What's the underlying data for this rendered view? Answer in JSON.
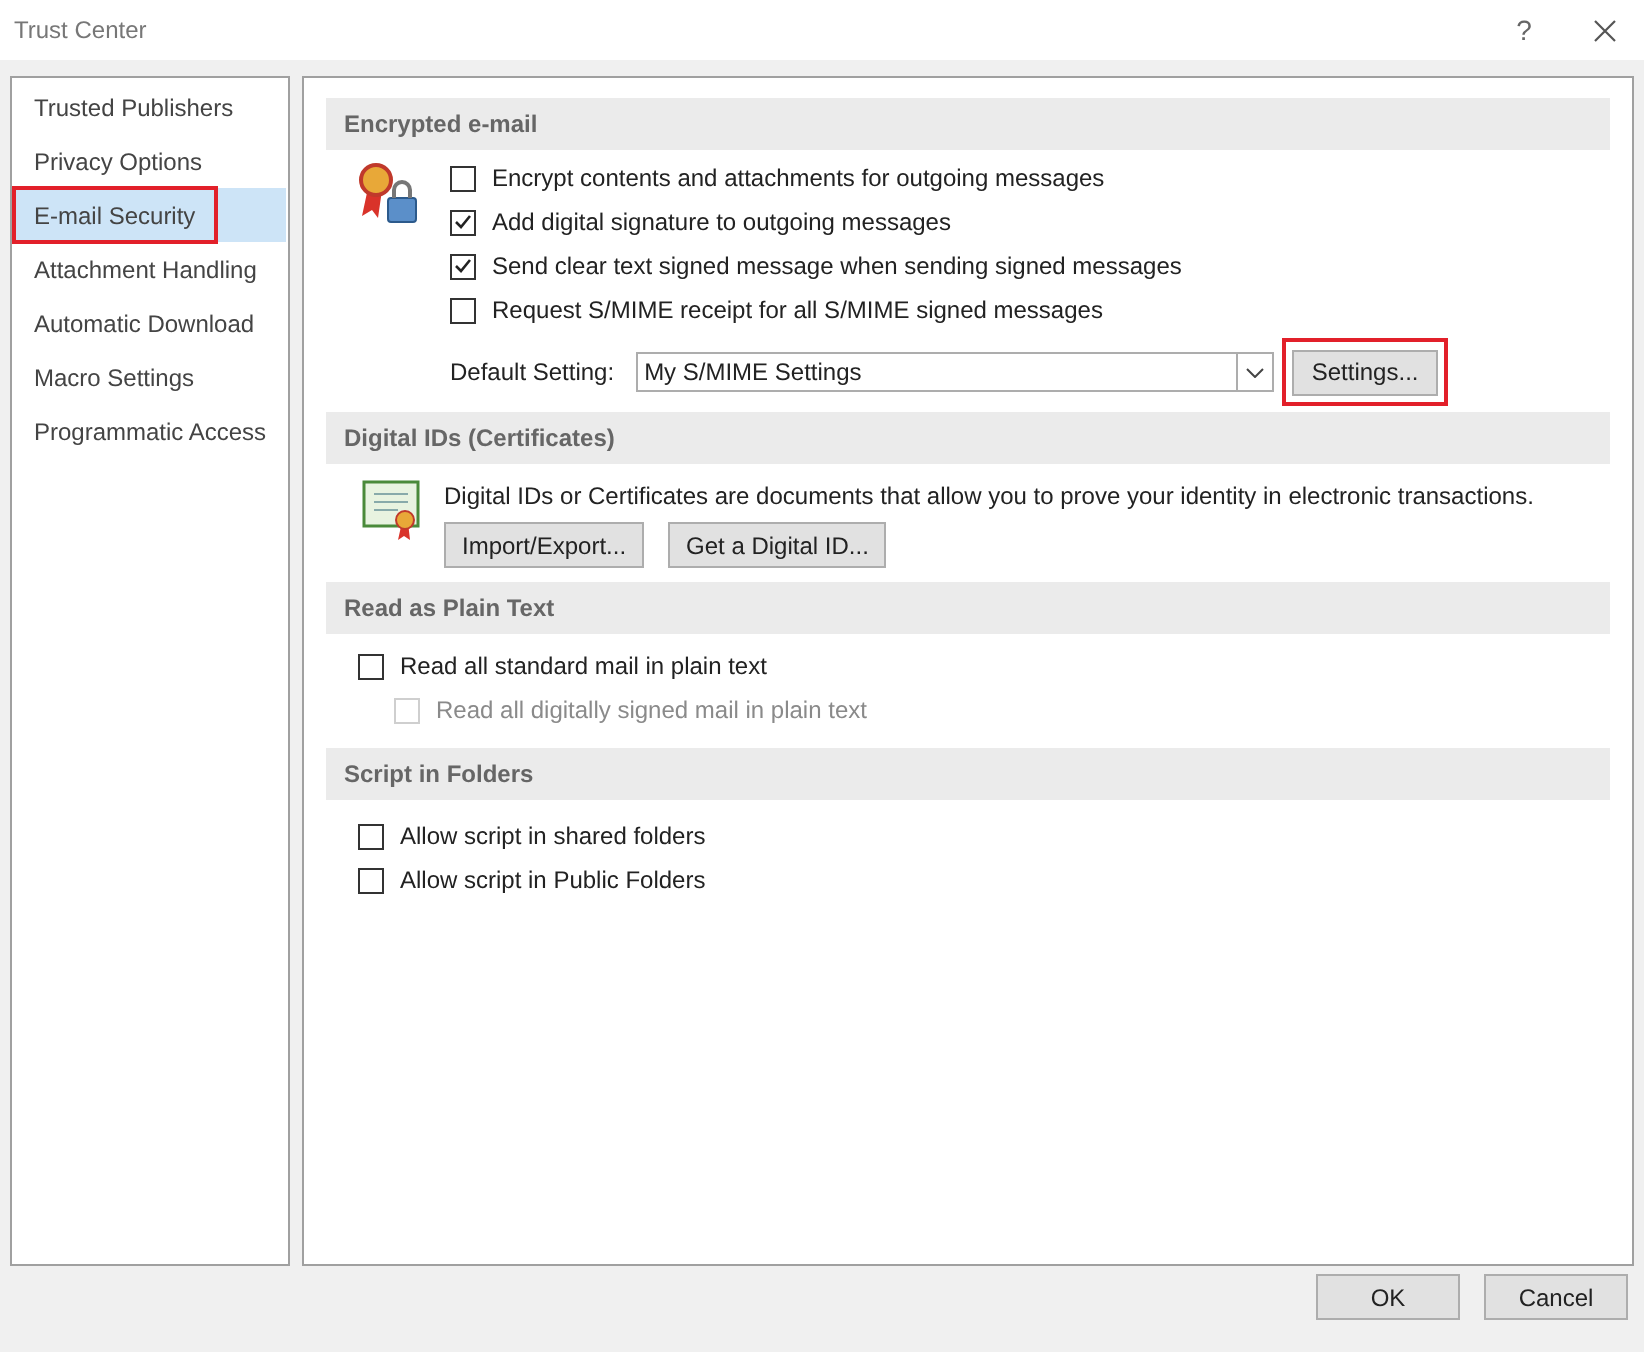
{
  "window": {
    "title": "Trust Center",
    "help": "?"
  },
  "sidebar": {
    "items": [
      {
        "label": "Trusted Publishers",
        "selected": false,
        "highlighted": false
      },
      {
        "label": "Privacy Options",
        "selected": false,
        "highlighted": false
      },
      {
        "label": "E-mail Security",
        "selected": true,
        "highlighted": true
      },
      {
        "label": "Attachment Handling",
        "selected": false,
        "highlighted": false
      },
      {
        "label": "Automatic Download",
        "selected": false,
        "highlighted": false
      },
      {
        "label": "Macro Settings",
        "selected": false,
        "highlighted": false
      },
      {
        "label": "Programmatic Access",
        "selected": false,
        "highlighted": false
      }
    ]
  },
  "encrypted": {
    "heading": "Encrypted e-mail",
    "options": [
      {
        "label": "Encrypt contents and attachments for outgoing messages",
        "checked": false
      },
      {
        "label": "Add digital signature to outgoing messages",
        "checked": true
      },
      {
        "label": "Send clear text signed message when sending signed messages",
        "checked": true
      },
      {
        "label": "Request S/MIME receipt for all S/MIME signed messages",
        "checked": false
      }
    ],
    "default_label": "Default Setting:",
    "default_value": "My S/MIME Settings",
    "settings_button": {
      "label": "Settings...",
      "highlighted": true
    }
  },
  "digital_ids": {
    "heading": "Digital IDs (Certificates)",
    "description": "Digital IDs or Certificates are documents that allow you to prove your identity in electronic transactions.",
    "buttons": [
      "Import/Export...",
      "Get a Digital ID..."
    ]
  },
  "plain_text": {
    "heading": "Read as Plain Text",
    "options": [
      {
        "label": "Read all standard mail in plain text",
        "checked": false,
        "disabled": false,
        "indented": false
      },
      {
        "label": "Read all digitally signed mail in plain text",
        "checked": false,
        "disabled": true,
        "indented": true
      }
    ]
  },
  "script": {
    "heading": "Script in Folders",
    "options": [
      {
        "label": "Allow script in shared folders",
        "checked": false
      },
      {
        "label": "Allow script in Public Folders",
        "checked": false
      }
    ]
  },
  "footer": {
    "buttons": [
      "OK",
      "Cancel"
    ]
  }
}
